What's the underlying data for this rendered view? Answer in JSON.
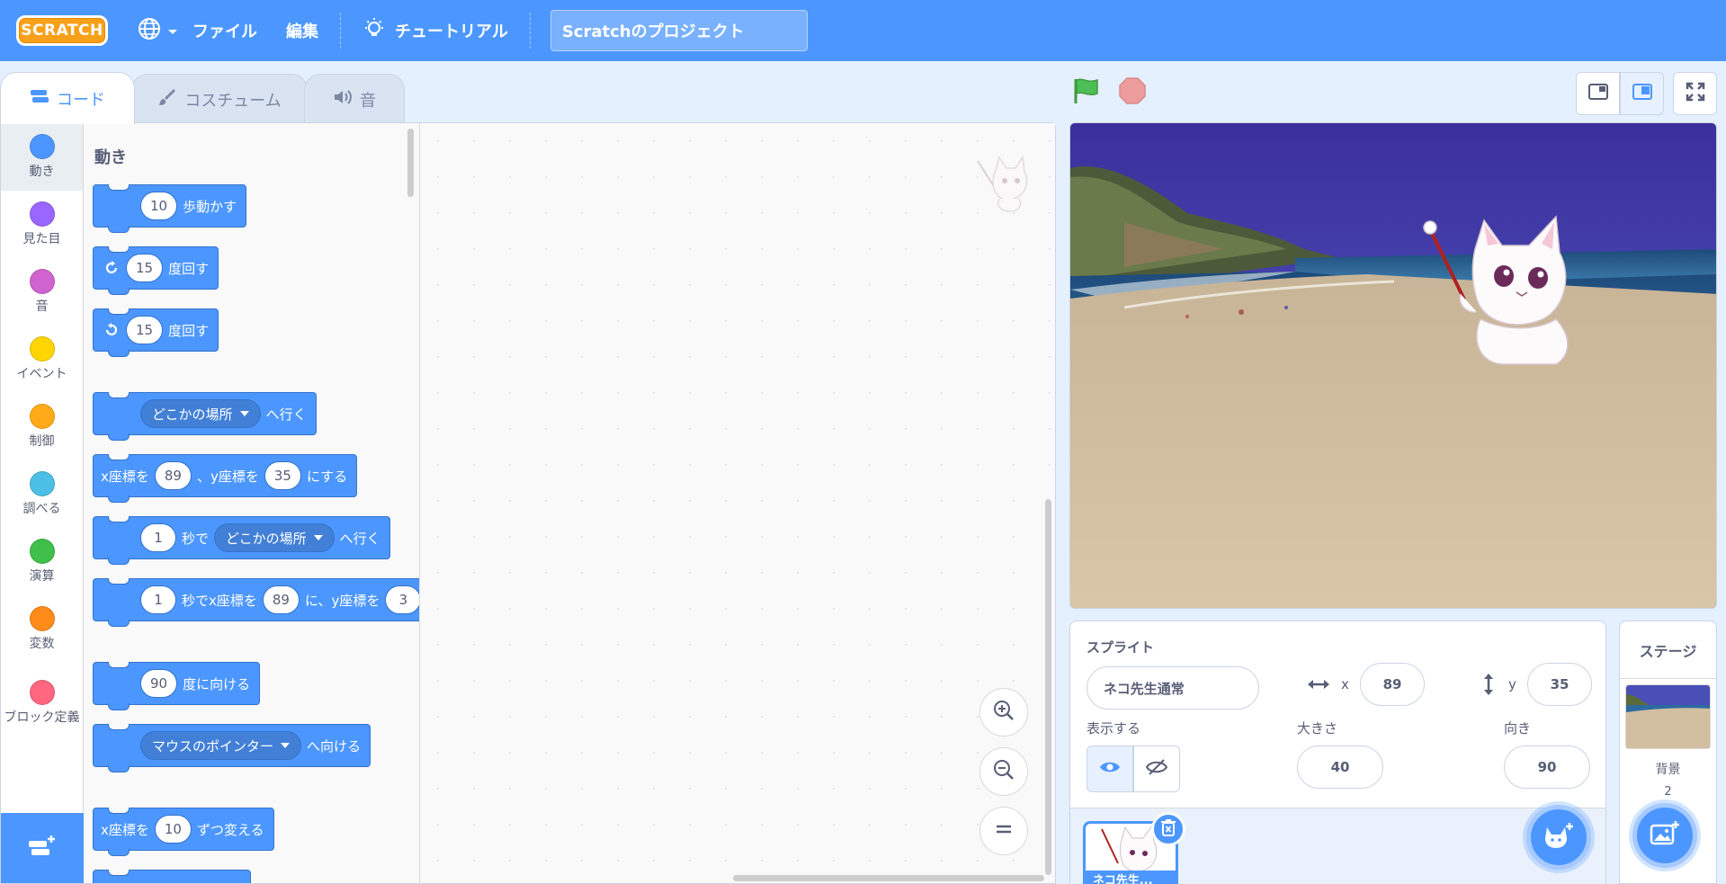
{
  "menubar": {
    "logo": "SCRATCH",
    "file_label": "ファイル",
    "edit_label": "編集",
    "tutorial_label": "チュートリアル",
    "project_title": "Scratchのプロジェクト"
  },
  "tabs": {
    "code": "コード",
    "costume": "コスチューム",
    "sound": "音"
  },
  "categories": [
    {
      "label": "動き",
      "color": "#4c97ff"
    },
    {
      "label": "見た目",
      "color": "#9966ff"
    },
    {
      "label": "音",
      "color": "#cf63cf"
    },
    {
      "label": "イベント",
      "color": "#ffd500"
    },
    {
      "label": "制御",
      "color": "#ffab19"
    },
    {
      "label": "調べる",
      "color": "#4cbfe6"
    },
    {
      "label": "演算",
      "color": "#40bf4a"
    },
    {
      "label": "変数",
      "color": "#ff8c1a"
    },
    {
      "label": "ブロック定義",
      "color": "#ff6680"
    }
  ],
  "palette": {
    "title": "動き",
    "move": {
      "value": "10",
      "text": "歩動かす"
    },
    "turn_right": {
      "value": "15",
      "text": "度回す"
    },
    "turn_left": {
      "value": "15",
      "text": "度回す"
    },
    "goto": {
      "menu": "どこかの場所",
      "text": "へ行く"
    },
    "goto_xy": {
      "x_label": "x座標を",
      "x": "89",
      "y_label": "、y座標を",
      "y": "35",
      "text": "にする"
    },
    "glide": {
      "secs": "1",
      "sec_label": "秒で",
      "menu": "どこかの場所",
      "text": "へ行く"
    },
    "glide_xy": {
      "secs": "1",
      "label": "秒でx座標を",
      "x": "89",
      "y_label": "に、y座標を",
      "y": "3"
    },
    "point_dir": {
      "value": "90",
      "text": "度に向ける"
    },
    "point_towards": {
      "menu": "マウスのポインター",
      "text": "へ向ける"
    },
    "change_x": {
      "label": "x座標を",
      "value": "10",
      "text": "ずつ変える"
    }
  },
  "sprite_info": {
    "sprite_label": "スプライト",
    "sprite_name": "ネコ先生通常",
    "x_label": "x",
    "x": "89",
    "y_label": "y",
    "y": "35",
    "show_label": "表示する",
    "size_label": "大きさ",
    "size": "40",
    "direction_label": "向き",
    "direction": "90",
    "thumb_name": "ネコ先生..."
  },
  "stage_selector": {
    "title": "ステージ",
    "backdrop_label": "背景",
    "backdrop_count": "2"
  },
  "colors": {
    "brand_blue": "#4c97ff",
    "menubar": "#4c97ff",
    "logo_orange": "#f9a01b",
    "green_flag": "#4cbf56",
    "stop": "#ec9c9c"
  },
  "icons": {
    "language": "globe-icon",
    "tutorial": "lightbulb-icon",
    "green_flag": "green-flag-icon",
    "stop": "stop-icon",
    "fullscreen": "fullscreen-icon"
  }
}
